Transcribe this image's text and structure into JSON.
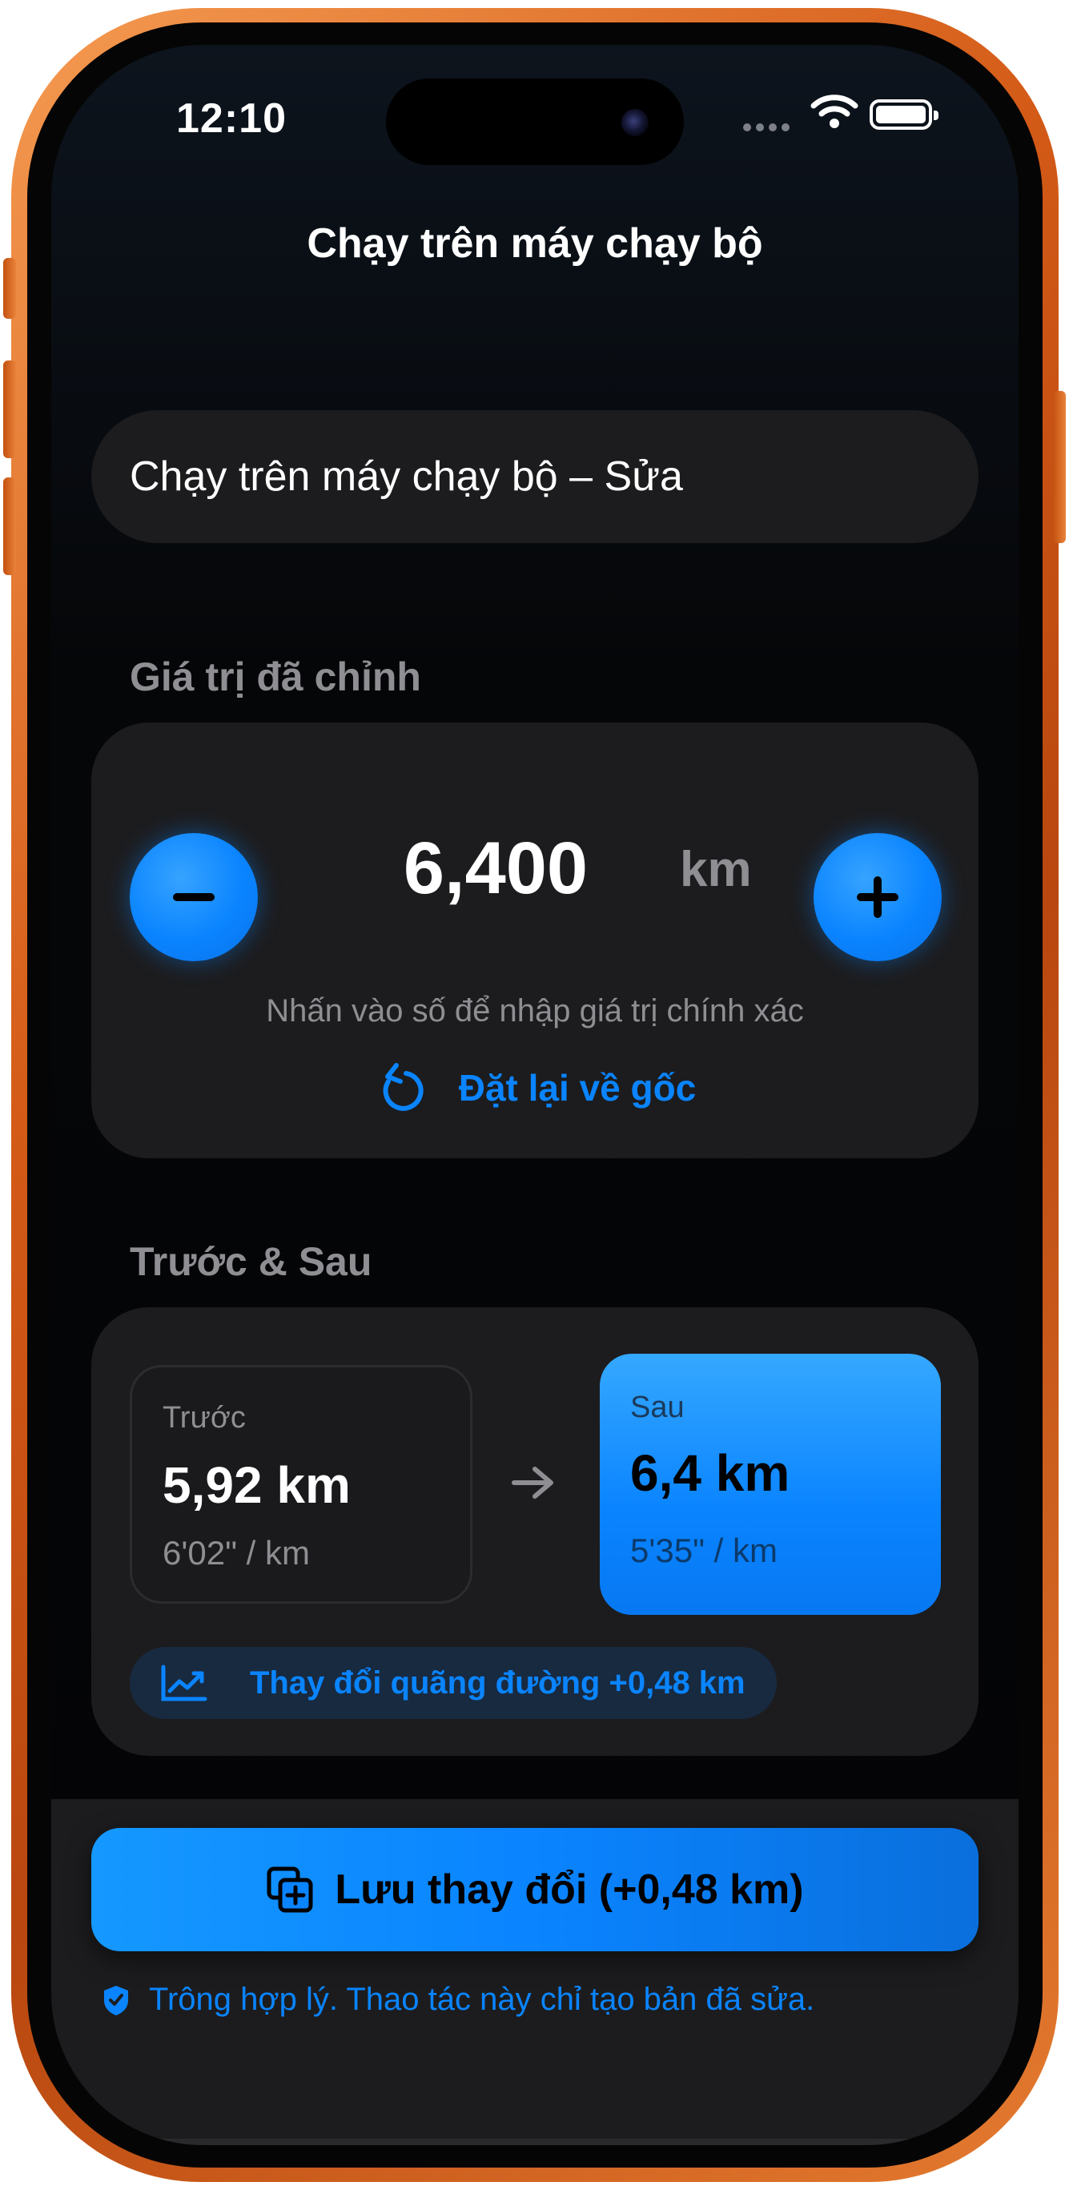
{
  "status_bar": {
    "time": "12:10"
  },
  "nav": {
    "title": "Chạy trên máy chạy bộ"
  },
  "name_field": {
    "value": "Chạy trên máy chạy bộ – Sửa"
  },
  "adjust": {
    "section_label": "Giá trị đã chỉnh",
    "value": "6,400",
    "unit": "km",
    "hint": "Nhấn vào số để nhập giá trị chính xác",
    "reset_label": "Đặt lại về gốc"
  },
  "compare": {
    "section_label": "Trước & Sau",
    "before": {
      "caption": "Trước",
      "value": "5,92 km",
      "pace": "6'02\" / km"
    },
    "after": {
      "caption": "Sau",
      "value": "6,4 km",
      "pace": "5'35\" / km"
    },
    "delta_label": "Thay đổi quãng đường +0,48 km"
  },
  "footer": {
    "save_label": "Lưu thay đổi (+0,48 km)",
    "note": "Trông hợp lý. Thao tác này chỉ tạo bản đã sửa."
  },
  "colors": {
    "accent": "#0a84ff",
    "frame": "#e07028",
    "card": "#1c1c1e",
    "secondary_text": "#8e8e93"
  },
  "icons": [
    "wifi-icon",
    "battery-icon",
    "minus-icon",
    "plus-icon",
    "reset-icon",
    "arrow-right-icon",
    "trend-up-icon",
    "duplicate-add-icon",
    "shield-check-icon"
  ]
}
